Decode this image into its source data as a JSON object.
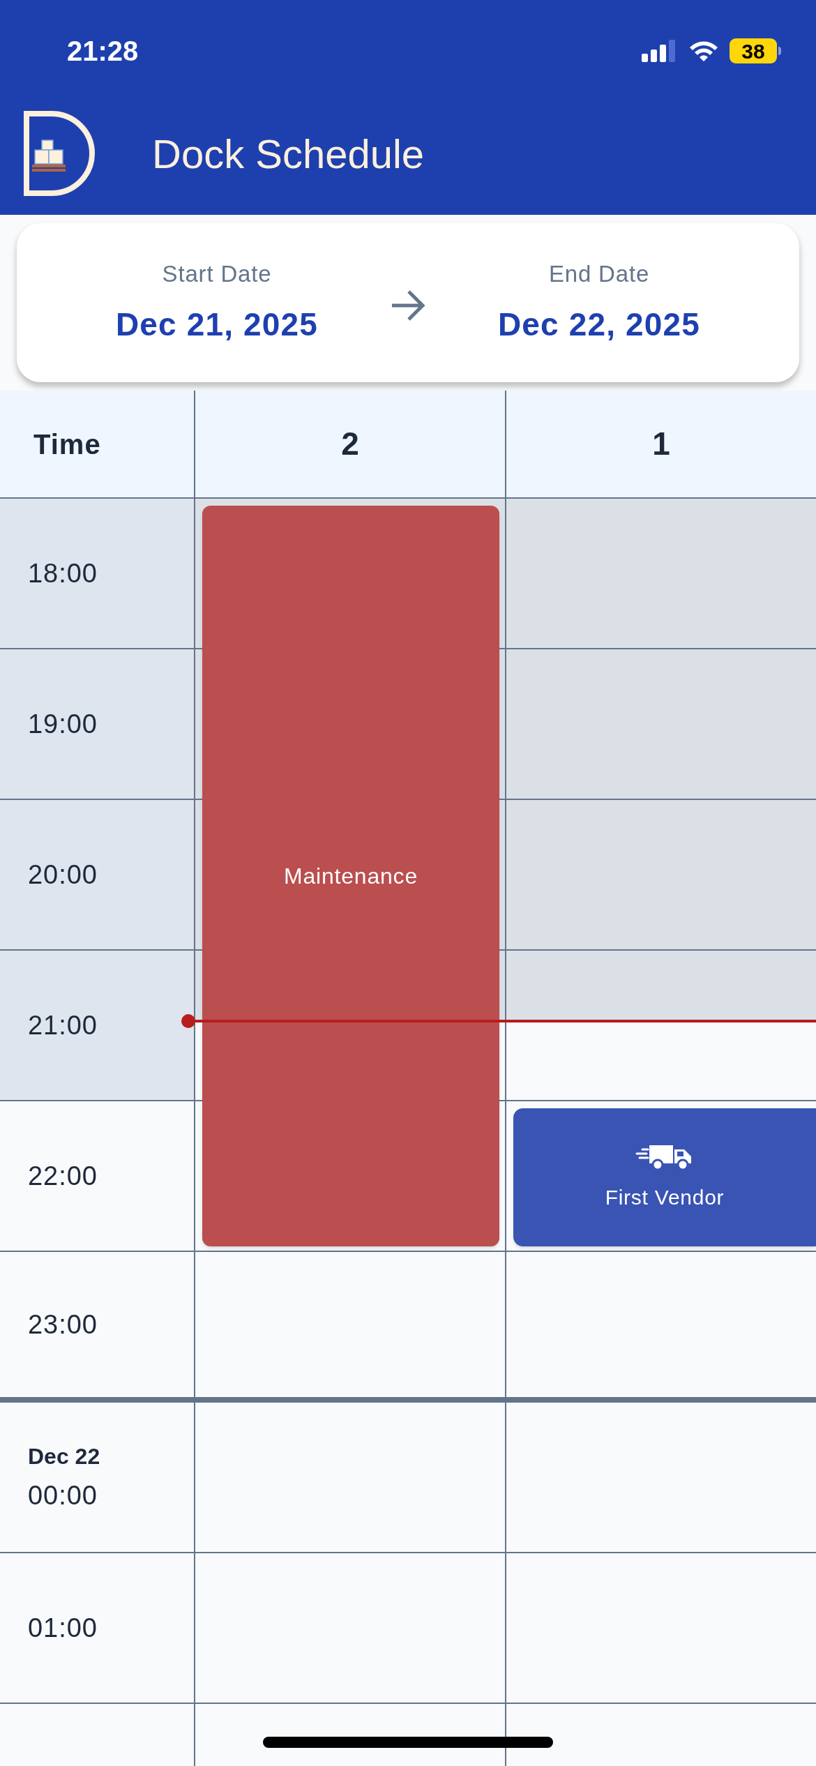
{
  "status_bar": {
    "time": "21:28",
    "battery": "38"
  },
  "header": {
    "title": "Dock Schedule"
  },
  "date_range": {
    "start_label": "Start Date",
    "start_value": "Dec 21, 2025",
    "end_label": "End Date",
    "end_value": "Dec 22, 2025"
  },
  "schedule": {
    "time_header": "Time",
    "columns": [
      {
        "label": "2",
        "events": [
          {
            "kind": "blocked",
            "title": "Maintenance"
          }
        ]
      },
      {
        "label": "1",
        "events": [
          {
            "kind": "delivery",
            "title": "First Vendor"
          }
        ]
      }
    ],
    "rows": [
      {
        "time": "18:00",
        "past": true,
        "slots": [
          {
            "booked": true
          },
          {
            "booked": false
          }
        ]
      },
      {
        "time": "19:00",
        "past": true,
        "slots": [
          {
            "booked": true
          },
          {
            "booked": false
          }
        ]
      },
      {
        "time": "20:00",
        "past": true,
        "slots": [
          {
            "booked": true
          },
          {
            "booked": false
          }
        ]
      },
      {
        "time": "21:00",
        "past": true,
        "slots": [
          {
            "booked": true
          },
          {
            "booked": false
          }
        ]
      },
      {
        "time": "22:00",
        "past": false,
        "slots": [
          {
            "booked": true
          },
          {
            "booked": true
          }
        ]
      },
      {
        "time": "23:00",
        "past": false,
        "slots": [
          {
            "booked": false
          },
          {
            "booked": false
          }
        ]
      },
      {
        "time": "00:00",
        "past": false,
        "date": "Dec 22",
        "slots": [
          {
            "booked": false
          },
          {
            "booked": false
          }
        ]
      },
      {
        "time": "01:00",
        "past": false,
        "slots": [
          {
            "booked": false
          },
          {
            "booked": false
          }
        ]
      }
    ]
  }
}
